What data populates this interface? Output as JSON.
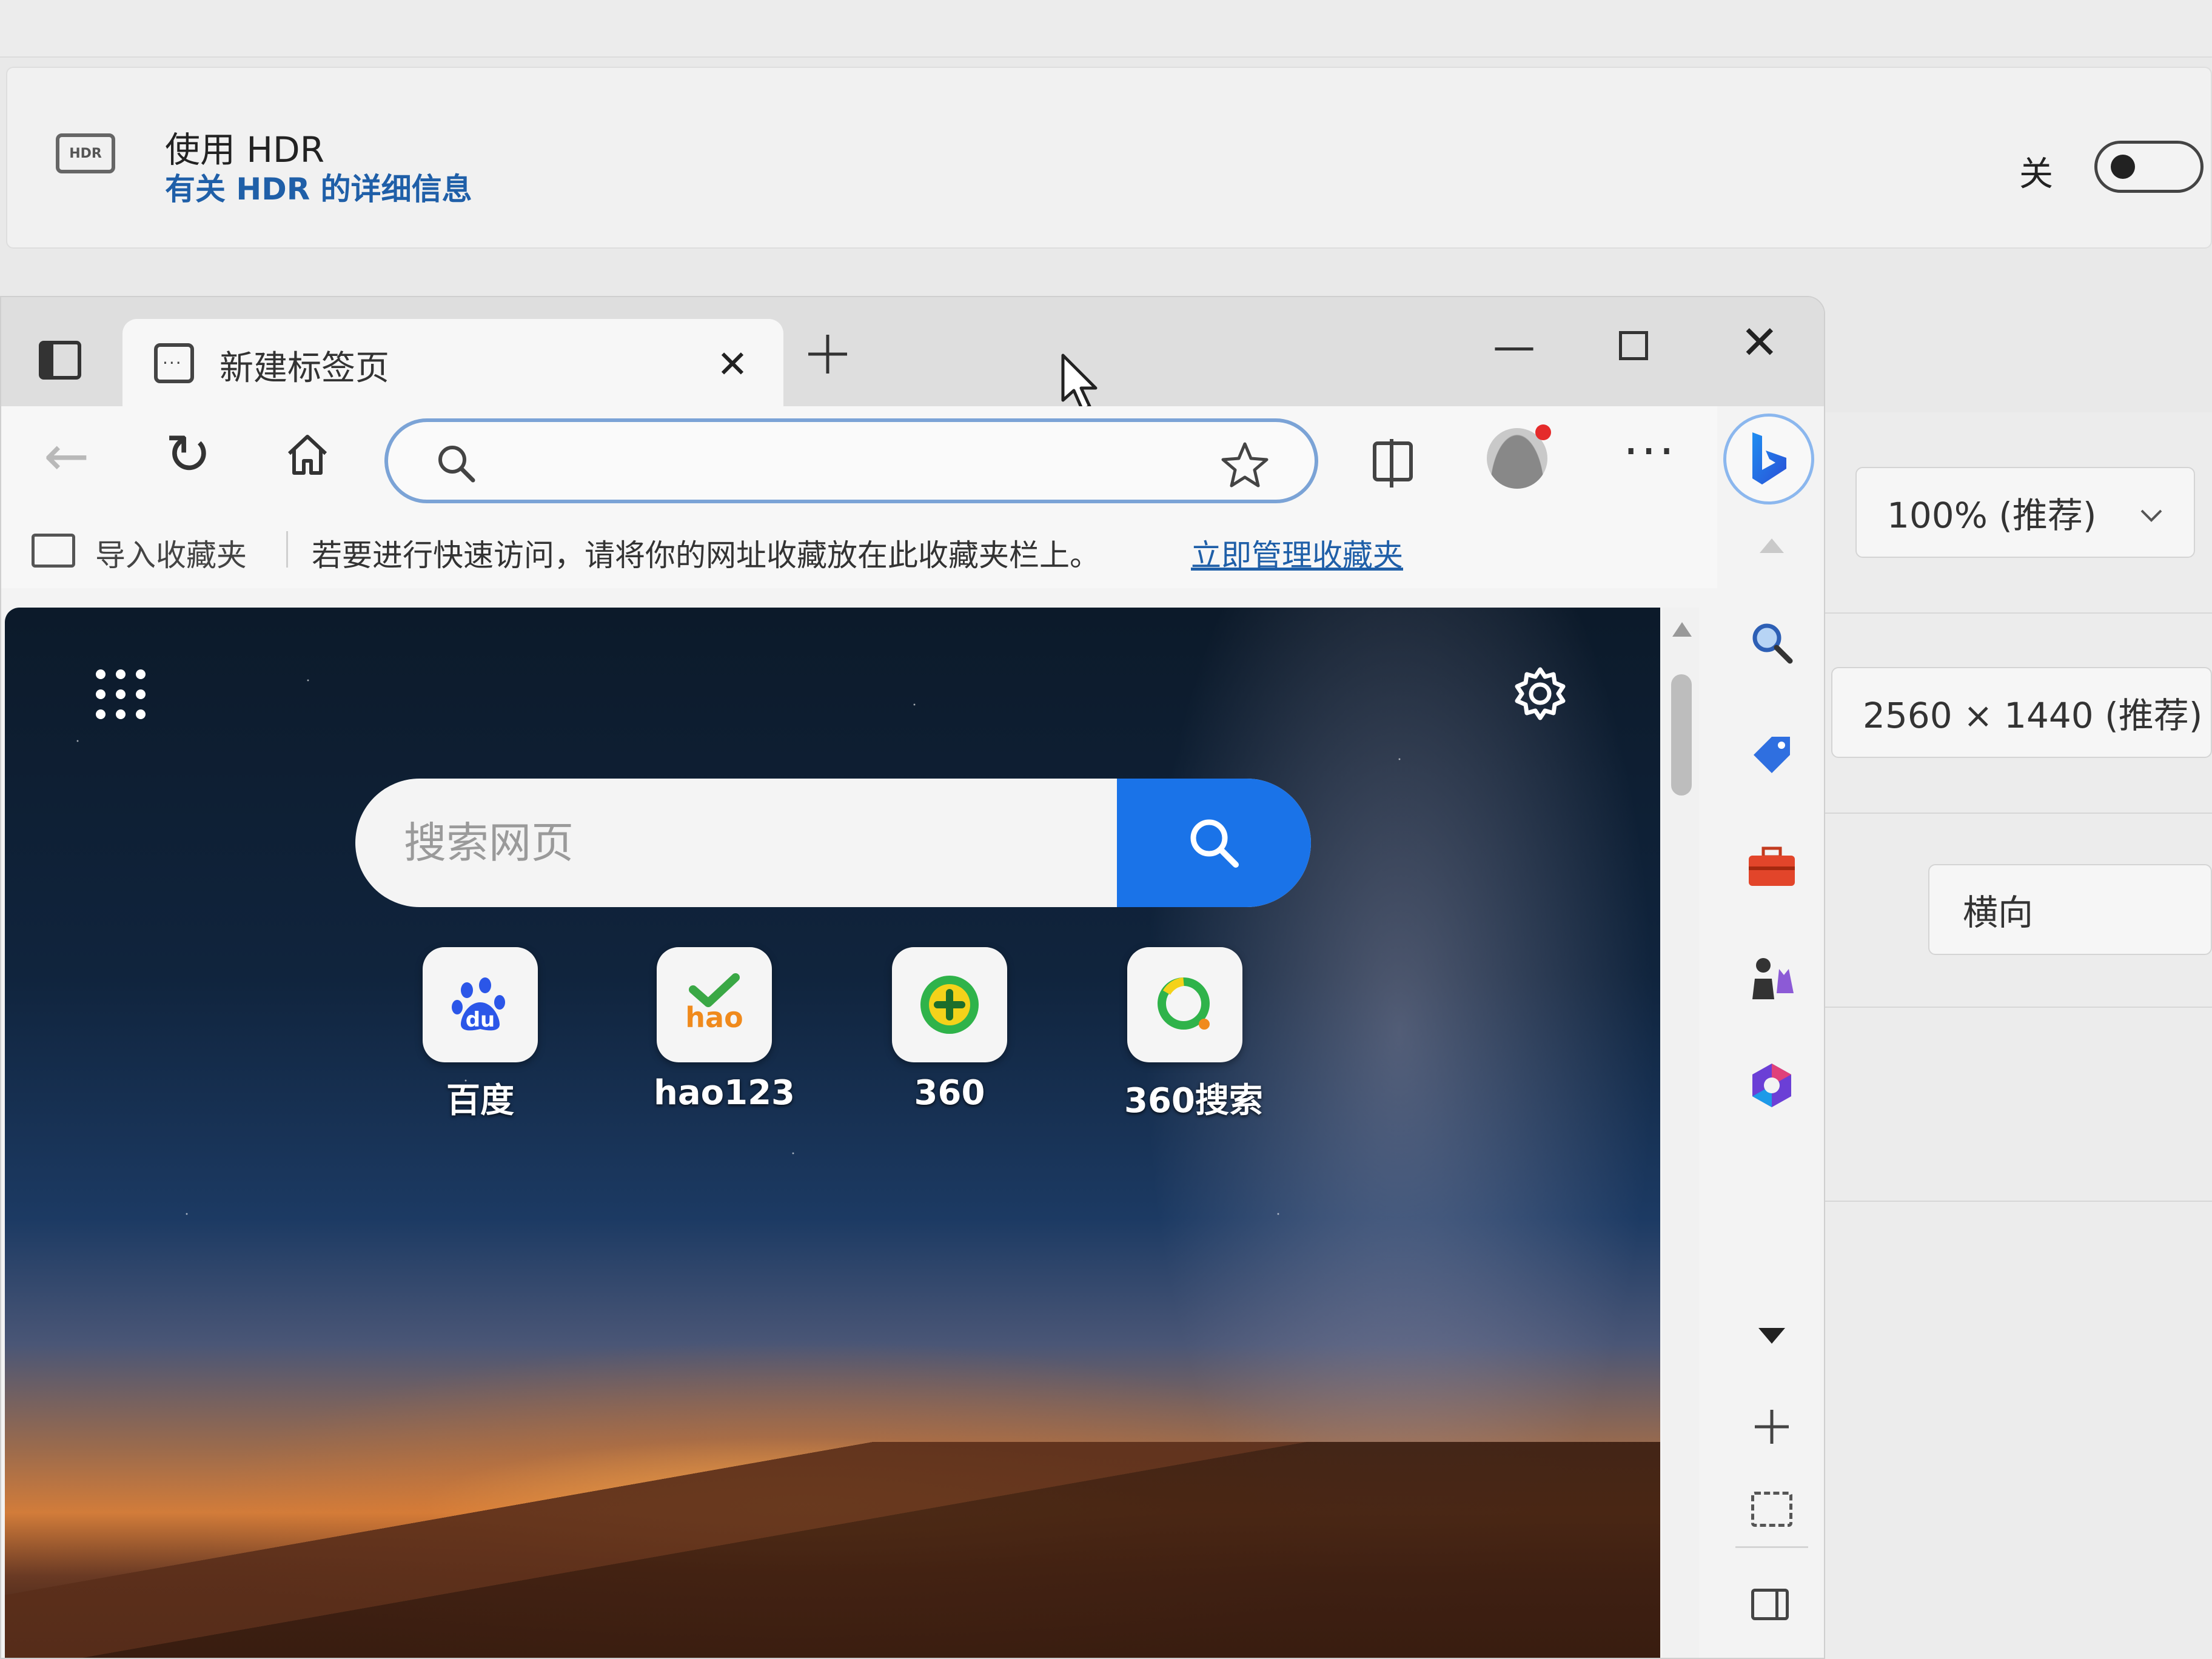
{
  "settings": {
    "hdr": {
      "icon": "hdr-icon",
      "icon_text": "HDR",
      "title": "使用 HDR",
      "link": "有关 HDR 的详细信息",
      "toggle_label": "关",
      "toggle_state": "off"
    },
    "scale": {
      "value": "100% (推荐)"
    },
    "resolution": {
      "value": "2560 × 1440 (推荐)"
    },
    "orientation": {
      "value": "横向"
    }
  },
  "browser": {
    "tab": {
      "title": "新建标签页",
      "close_label": "✕"
    },
    "window_controls": {
      "minimize": "—",
      "close": "✕"
    },
    "toolbar": {
      "back": "←",
      "refresh": "↻",
      "address_value": "",
      "more": "···"
    },
    "favorites_bar": {
      "import_label": "导入收藏夹",
      "hint": "若要进行快速访问，请将你的网址收藏放在此收藏夹栏上。",
      "manage_link": "立即管理收藏夹"
    },
    "page": {
      "search_placeholder": "搜索网页",
      "quicklinks": [
        {
          "label": "百度",
          "icon": "baidu-icon"
        },
        {
          "label": "hao123",
          "icon": "hao123-icon"
        },
        {
          "label": "360",
          "icon": "360-icon"
        },
        {
          "label": "360搜索",
          "icon": "360-search-icon"
        }
      ]
    },
    "sidebar": {
      "items": [
        {
          "icon": "search-icon"
        },
        {
          "icon": "shopping-tag-icon"
        },
        {
          "icon": "tools-icon"
        },
        {
          "icon": "games-icon"
        },
        {
          "icon": "microsoft365-icon"
        }
      ]
    }
  },
  "colors": {
    "accent": "#1a73e8",
    "link": "#1f5fa8",
    "notification_dot": "#e52b2b"
  }
}
